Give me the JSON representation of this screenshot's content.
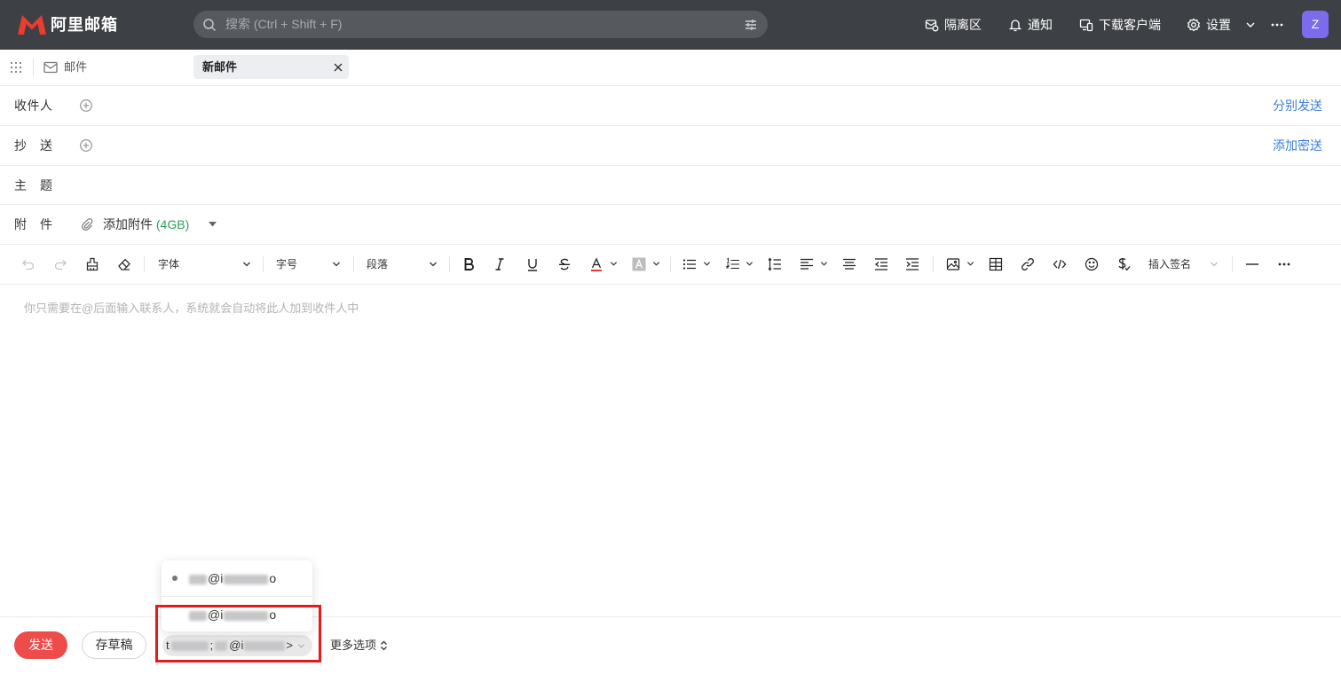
{
  "app": {
    "logo_text": "阿里邮箱"
  },
  "search": {
    "placeholder": "搜索 (Ctrl + Shift + F)"
  },
  "topnav": {
    "quarantine": "隔离区",
    "notifications": "通知",
    "download_client": "下载客户端",
    "settings": "设置",
    "avatar_letter": "Z"
  },
  "subnav": {
    "mail": "邮件",
    "active_tab": "新邮件"
  },
  "compose": {
    "to": {
      "label": "收件人",
      "action": "分别发送"
    },
    "cc": {
      "label": "抄 送",
      "action": "添加密送"
    },
    "subject": {
      "label": "主 题"
    },
    "attachment": {
      "label": "附 件",
      "add": "添加附件",
      "limit": "(4GB)"
    }
  },
  "toolbar": {
    "font_family": "字体",
    "font_size": "字号",
    "paragraph": "段落",
    "signature": "插入签名"
  },
  "editor": {
    "placeholder": "你只需要在@后面输入联系人，系统就会自动将此人加到收件人中"
  },
  "footer": {
    "send": "发送",
    "save_draft": "存草稿",
    "sender_select": {
      "parts": [
        "t",
        ";",
        "@i",
        ">"
      ]
    },
    "more_options": "更多选项"
  },
  "sender_popup": {
    "options": [
      {
        "at": "@i",
        "tail": "o",
        "selected": true
      },
      {
        "at": "@i",
        "tail": "o",
        "selected": false
      }
    ]
  },
  "colors": {
    "topbar": "#3d4045",
    "logo": "#ea3c2f",
    "send_button": "#ee4b4b",
    "link": "#3b7ddd",
    "attachment_limit": "#2f9e5a",
    "avatar": "#7c6bea",
    "highlight_box": "#e6191d"
  },
  "icons": [
    "logo-icon",
    "search-icon",
    "filter-icon",
    "quarantine-icon",
    "bell-icon",
    "download-client-icon",
    "gear-icon",
    "chevron-down-icon",
    "more-icon",
    "apps-grid-icon",
    "mail-icon",
    "close-icon",
    "add-circle-icon",
    "paperclip-icon",
    "undo-icon",
    "redo-icon",
    "format-painter-icon",
    "eraser-icon",
    "bold-icon",
    "italic-icon",
    "underline-icon",
    "strikethrough-icon",
    "font-color-icon",
    "highlight-color-icon",
    "bulleted-list-icon",
    "numbered-list-icon",
    "line-height-icon",
    "align-left-icon",
    "justify-icon",
    "outdent-icon",
    "indent-icon",
    "image-icon",
    "table-icon",
    "link-icon",
    "code-icon",
    "emoji-icon",
    "signature-icon",
    "horizontal-rule-icon",
    "more-horizontal-icon",
    "sort-icon"
  ]
}
